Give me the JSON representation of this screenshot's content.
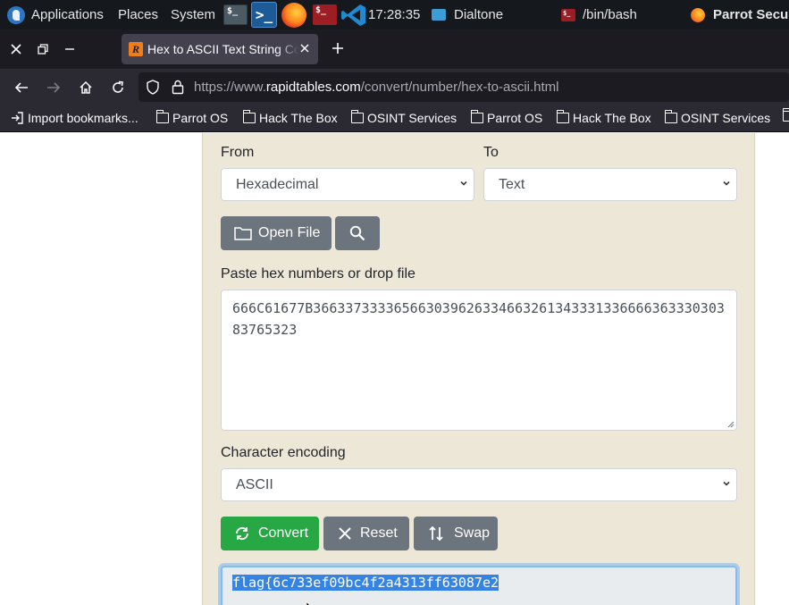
{
  "system_panel": {
    "applications": "Applications",
    "places": "Places",
    "system": "System",
    "clock": "17:28:35",
    "dialtone_label": "Dialtone",
    "bash_label": "/bin/bash",
    "parrot_label": "Parrot Security"
  },
  "browser": {
    "tab_title": "Hex to ASCII Text String Converter",
    "url_scheme_prefix": "https://www.",
    "url_host": "rapidtables.com",
    "url_path": "/convert/number/hex-to-ascii.html",
    "bookmarks": [
      "Import bookmarks...",
      "Parrot OS",
      "Hack The Box",
      "OSINT Services",
      "Parrot OS",
      "Hack The Box",
      "OSINT Services"
    ]
  },
  "converter": {
    "from_label": "From",
    "to_label": "To",
    "from_value": "Hexadecimal",
    "to_value": "Text",
    "open_file_label": "Open File",
    "input_label": "Paste hex numbers or drop file",
    "input_value": "666C61677B36633733336566303962633466326134333133666636333030383765323",
    "encoding_label": "Character encoding",
    "encoding_value": "ASCII",
    "convert_label": "Convert",
    "reset_label": "Reset",
    "swap_label": "Swap",
    "output_value": "flag{6c733ef09bc4f2a4313ff63087e2"
  }
}
